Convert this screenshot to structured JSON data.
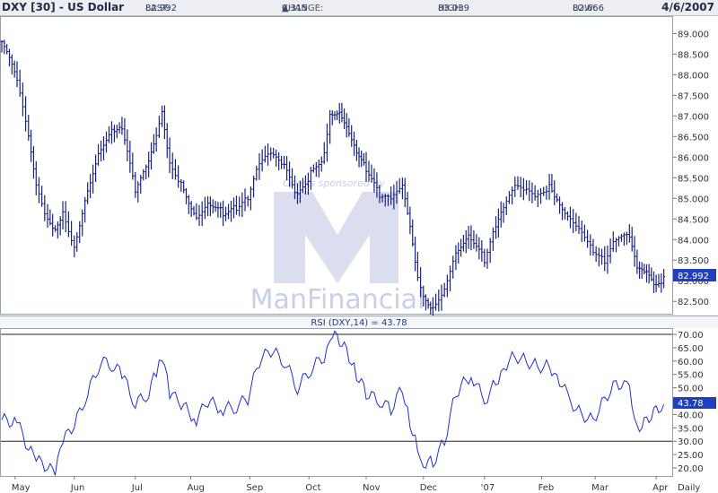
{
  "header": {
    "symbol": "DXY [30] - US Dollar",
    "last_label": "LAST:",
    "last_value": "82.992",
    "change_label": "CHANGE:",
    "change_value": "0.315",
    "high_label": "HIGH:",
    "high_value": "83.039",
    "low_label": "LOW:",
    "low_value": "82.666",
    "date": "4/6/2007"
  },
  "watermark": {
    "sponsor_text": "Charts sponsored by",
    "brand": "ManFinancial"
  },
  "colors": {
    "price": "#1a237e",
    "rsi": "#2030c8",
    "badge": "#1e40c0",
    "watermark": "#c9cfe6"
  },
  "chart_data": [
    {
      "type": "ohlc",
      "title": "DXY [30] - US Dollar",
      "interval": "Daily",
      "last_label": "82.992",
      "ylim": [
        82.2,
        89.4
      ],
      "yticks": [
        "82.500",
        "83.000",
        "83.500",
        "84.000",
        "84.500",
        "85.000",
        "85.500",
        "86.000",
        "86.500",
        "87.000",
        "87.500",
        "88.000",
        "88.500",
        "89.000"
      ],
      "x_labels": [
        "May",
        "Jun",
        "Jul",
        "Aug",
        "Sep",
        "Oct",
        "Nov",
        "Dec",
        "'07",
        "Feb",
        "Mar",
        "Apr",
        "Daily"
      ],
      "series": [
        {
          "x": [
            "2006-04-24",
            "2006-05-02",
            "2006-05-08",
            "2006-05-12",
            "2006-05-18",
            "2006-05-22",
            "2006-05-26",
            "2006-06-01",
            "2006-06-08",
            "2006-06-15",
            "2006-06-22",
            "2006-06-26",
            "2006-07-03",
            "2006-07-10",
            "2006-07-14",
            "2006-07-17",
            "2006-07-21",
            "2006-07-27",
            "2006-08-04",
            "2006-08-10",
            "2006-08-18",
            "2006-08-25",
            "2006-08-31",
            "2006-09-06",
            "2006-09-12",
            "2006-09-19",
            "2006-09-26",
            "2006-10-03",
            "2006-10-10",
            "2006-10-13",
            "2006-10-18",
            "2006-10-23",
            "2006-10-27",
            "2006-11-01",
            "2006-11-08",
            "2006-11-14",
            "2006-11-20",
            "2006-11-24",
            "2006-11-28",
            "2006-12-01",
            "2006-12-06",
            "2006-12-12",
            "2006-12-18",
            "2006-12-26",
            "2007-01-02",
            "2007-01-08",
            "2007-01-12",
            "2007-01-18",
            "2007-01-24",
            "2007-01-30",
            "2007-02-05",
            "2007-02-09",
            "2007-02-16",
            "2007-02-22",
            "2007-02-28",
            "2007-03-06",
            "2007-03-12",
            "2007-03-19",
            "2007-03-23",
            "2007-03-28",
            "2007-04-02",
            "2007-04-06"
          ],
          "close": [
            88.8,
            87.8,
            86.4,
            85.2,
            84.4,
            84.2,
            84.7,
            83.9,
            85.3,
            86.3,
            86.7,
            86.7,
            85.1,
            85.8,
            86.4,
            87.0,
            85.8,
            85.4,
            84.6,
            85.0,
            84.7,
            84.8,
            85.0,
            85.8,
            86.0,
            85.7,
            85.0,
            85.6,
            86.1,
            87.1,
            87.2,
            86.7,
            86.2,
            85.7,
            85.0,
            84.9,
            85.2,
            84.2,
            83.0,
            82.6,
            82.4,
            82.9,
            83.8,
            84.1,
            83.5,
            84.3,
            84.7,
            85.2,
            85.1,
            85.0,
            85.3,
            85.0,
            84.6,
            84.3,
            83.8,
            83.5,
            84.0,
            84.0,
            83.2,
            83.1,
            82.8,
            82.99
          ]
        }
      ]
    },
    {
      "type": "line",
      "title": "RSI (DXY,14) = 43.78",
      "last_label": "43.78",
      "ylim": [
        17,
        72
      ],
      "yticks": [
        "20.00",
        "25.00",
        "30.00",
        "35.00",
        "40.00",
        "45.00",
        "50.00",
        "55.00",
        "60.00",
        "65.00",
        "70.00"
      ],
      "reference_lines": [
        70,
        30
      ],
      "series": [
        {
          "name": "RSI (DXY,14)",
          "x": [
            "2006-04-24",
            "2006-05-02",
            "2006-05-08",
            "2006-05-12",
            "2006-05-18",
            "2006-05-22",
            "2006-05-26",
            "2006-06-01",
            "2006-06-08",
            "2006-06-15",
            "2006-06-22",
            "2006-06-26",
            "2006-07-03",
            "2006-07-10",
            "2006-07-14",
            "2006-07-17",
            "2006-07-21",
            "2006-07-27",
            "2006-08-04",
            "2006-08-10",
            "2006-08-18",
            "2006-08-25",
            "2006-08-31",
            "2006-09-06",
            "2006-09-12",
            "2006-09-19",
            "2006-09-26",
            "2006-10-03",
            "2006-10-10",
            "2006-10-13",
            "2006-10-18",
            "2006-10-23",
            "2006-10-27",
            "2006-11-01",
            "2006-11-08",
            "2006-11-14",
            "2006-11-20",
            "2006-11-24",
            "2006-11-28",
            "2006-12-01",
            "2006-12-06",
            "2006-12-12",
            "2006-12-18",
            "2006-12-26",
            "2007-01-02",
            "2007-01-08",
            "2007-01-12",
            "2007-01-18",
            "2007-01-24",
            "2007-01-30",
            "2007-02-05",
            "2007-02-09",
            "2007-02-16",
            "2007-02-22",
            "2007-02-28",
            "2007-03-06",
            "2007-03-12",
            "2007-03-19",
            "2007-03-23",
            "2007-03-28",
            "2007-04-02",
            "2007-04-06"
          ],
          "values": [
            38,
            37,
            27,
            23,
            20,
            18,
            30,
            36,
            48,
            60,
            58,
            55,
            44,
            48,
            56,
            62,
            48,
            44,
            38,
            45,
            42,
            43,
            46,
            60,
            64,
            60,
            50,
            57,
            62,
            70,
            68,
            62,
            55,
            48,
            45,
            42,
            50,
            37,
            28,
            22,
            22,
            30,
            48,
            55,
            45,
            52,
            58,
            62,
            60,
            58,
            58,
            55,
            45,
            40,
            38,
            46,
            52,
            50,
            35,
            38,
            42,
            43.78
          ]
        }
      ]
    }
  ]
}
